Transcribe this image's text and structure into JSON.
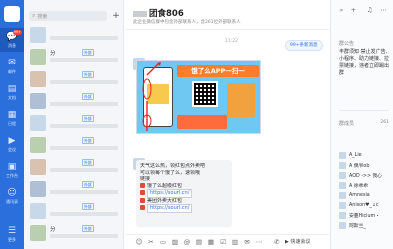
{
  "sidebar": {
    "badge": "99+",
    "items": [
      {
        "icon": "chat-icon",
        "glyph": "💬",
        "label": "消息"
      },
      {
        "icon": "mail-icon",
        "glyph": "✉",
        "label": "邮件"
      },
      {
        "icon": "doc-icon",
        "glyph": "▤",
        "label": "文档"
      },
      {
        "icon": "calendar-icon",
        "glyph": "▦",
        "label": "日程"
      },
      {
        "icon": "meeting-icon",
        "glyph": "▶",
        "label": "会议"
      },
      {
        "icon": "workbench-icon",
        "glyph": "▣",
        "label": "工作台"
      },
      {
        "icon": "contacts-icon",
        "glyph": "☺",
        "label": "通讯录"
      },
      {
        "icon": "more-icon",
        "glyph": "☰",
        "label": "更多"
      }
    ]
  },
  "conversations": {
    "search_placeholder": "搜索",
    "items": [
      {
        "name": "",
        "tag": "",
        "time": ""
      },
      {
        "name": "分",
        "tag": "外部",
        "time": ""
      },
      {
        "name": "",
        "tag": "外部",
        "time": ""
      },
      {
        "name": "",
        "tag": "外部",
        "time": ""
      },
      {
        "name": "",
        "tag": "外部",
        "time": ""
      },
      {
        "name": "",
        "tag": "外部",
        "time": ""
      },
      {
        "name": "",
        "tag": "外部",
        "time": ""
      },
      {
        "name": "",
        "tag": "外部",
        "time": ""
      },
      {
        "name": "",
        "tag": "外部",
        "time": ""
      },
      {
        "name": "",
        "tag": "外部",
        "time": ""
      },
      {
        "name": "分",
        "tag": "外部",
        "time": ""
      }
    ]
  },
  "chat": {
    "title": "团食806",
    "subtitle": "此企业微信群中包含外部联系人，含261位外部联系人",
    "timestamp": "11:22",
    "pinned_label": "99+条新消息",
    "poster_heading": "饿了么APP一扫一",
    "bubble": {
      "line1": "天气这么热，领红包点外卖吧",
      "line2": "可以领每个饿了么，速领哦",
      "line3": "链接",
      "line4": "饿了么超级红包",
      "url1": "https://sourl.cn/",
      "line5": "美团外卖大红包",
      "url2": "https://sourl.cn/"
    },
    "toolbar": {
      "meeting_label": "快速会议"
    }
  },
  "panel": {
    "notice_label": "群公告",
    "notice": "丰群须知 禁止发广告、小程序、助力链接、拉票链接，违者立即踢出群",
    "members_label": "群成员",
    "member_count": "261",
    "members": [
      "A_Lie",
      "A 偶爷ob",
      "AOD ->> 我心",
      "A 徐乖乖",
      "Amnesia",
      "Anison♥_↓c",
      "安蔓Hicium・",
      "阿斯兰_"
    ]
  }
}
